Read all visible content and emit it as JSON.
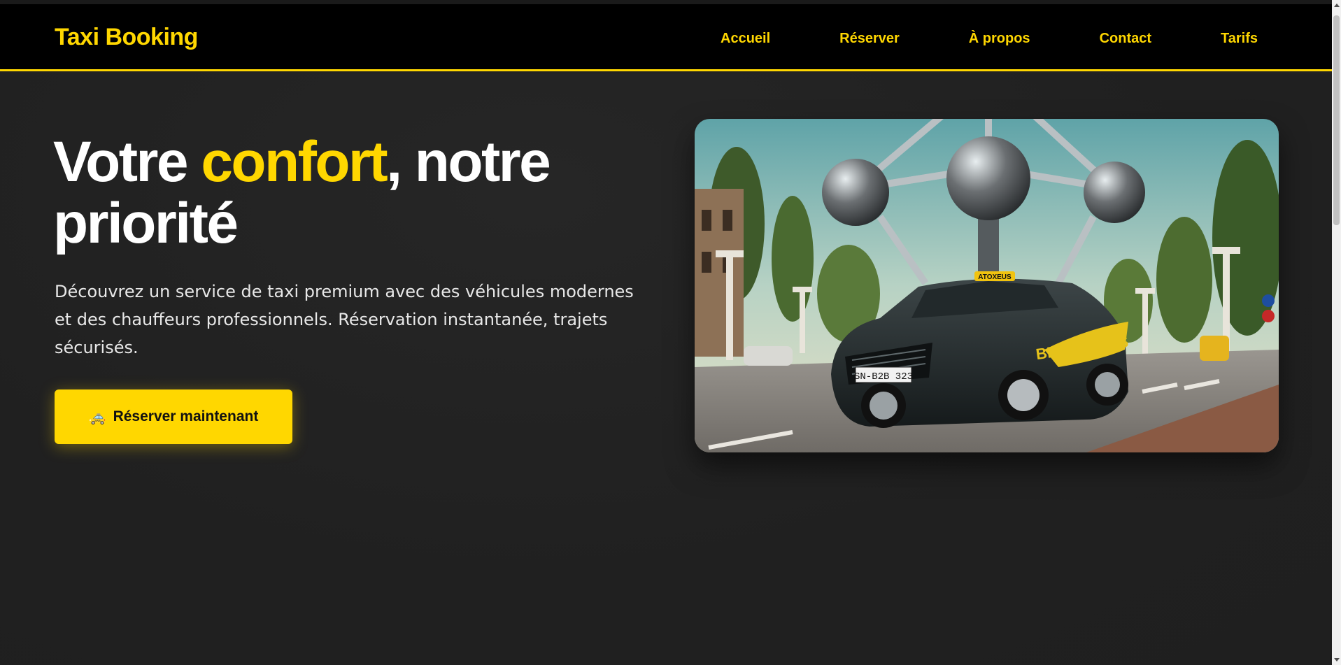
{
  "nav": {
    "brand": "Taxi Booking",
    "links": [
      "Accueil",
      "Réserver",
      "À propos",
      "Contact",
      "Tarifs"
    ]
  },
  "hero": {
    "title_part1": "Votre ",
    "title_accent": "confort",
    "title_part2": ", notre priorité",
    "lead": "Découvrez un service de taxi premium avec des véhicules modernes et des chauffeurs professionnels. Réservation instantanée, trajets sécurisés.",
    "cta_icon": "🚕",
    "cta_label": "Réserver maintenant"
  },
  "image": {
    "roof_sign": "ATOXEUS",
    "door_text": "BRUXELLES",
    "plate": "SN-B2B 323"
  },
  "colors": {
    "accent": "#FFD700",
    "nav_bg": "#000000",
    "page_bg": "#222222"
  }
}
